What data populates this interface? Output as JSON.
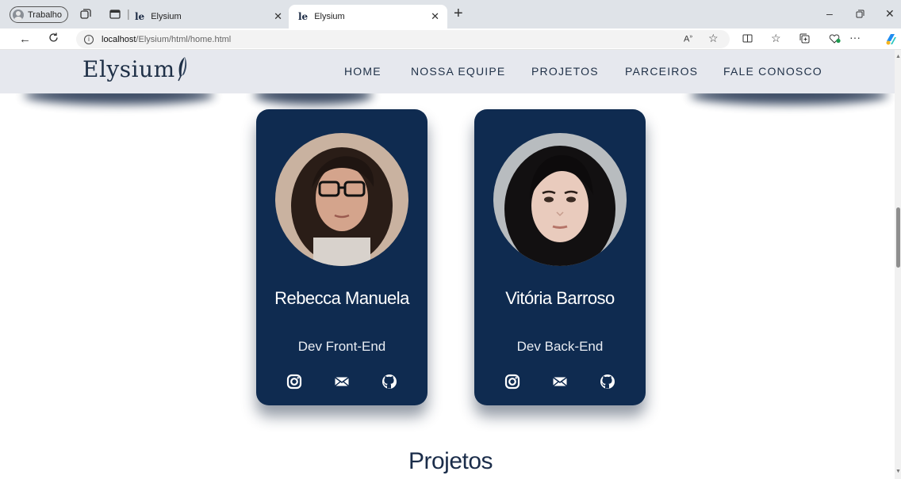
{
  "browser": {
    "profile_label": "Trabalho",
    "tabs": [
      {
        "title": "Elysium",
        "active": false
      },
      {
        "title": "Elysium",
        "active": true
      }
    ],
    "url_host": "localhost",
    "url_path": "/Elysium/html/home.html"
  },
  "site": {
    "logo": "Elysium",
    "nav": [
      "HOME",
      "NOSSA EQUIPE",
      "PROJETOS",
      "PARCEIROS",
      "FALE CONOSCO"
    ]
  },
  "team": [
    {
      "name": "Rebecca Manuela",
      "role": "Dev Front-End",
      "links": [
        "instagram-icon",
        "mail-icon",
        "github-icon"
      ]
    },
    {
      "name": "Vitória Barroso",
      "role": "Dev Back-End",
      "links": [
        "instagram-icon",
        "mail-icon",
        "github-icon"
      ]
    }
  ],
  "sections": {
    "projects_title": "Projetos"
  },
  "colors": {
    "card_bg": "#0f2b50",
    "header_bg": "#e6e8ee",
    "text_dark": "#1f3047"
  }
}
